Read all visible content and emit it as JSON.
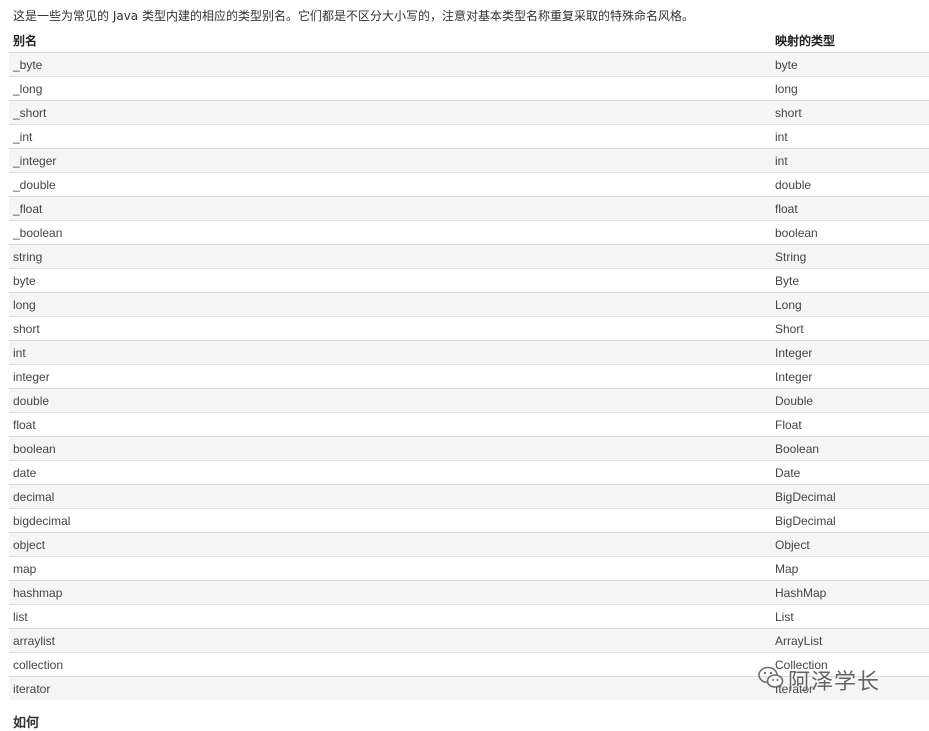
{
  "intro_text": "这是一些为常见的 Java 类型内建的相应的类型别名。它们都是不区分大小写的，注意对基本类型名称重复采取的特殊命名风格。",
  "table": {
    "headers": {
      "alias": "别名",
      "mapped_type": "映射的类型"
    },
    "rows": [
      {
        "alias": "_byte",
        "type": "byte"
      },
      {
        "alias": "_long",
        "type": "long"
      },
      {
        "alias": "_short",
        "type": "short"
      },
      {
        "alias": "_int",
        "type": "int"
      },
      {
        "alias": "_integer",
        "type": "int"
      },
      {
        "alias": "_double",
        "type": "double"
      },
      {
        "alias": "_float",
        "type": "float"
      },
      {
        "alias": "_boolean",
        "type": "boolean"
      },
      {
        "alias": "string",
        "type": "String"
      },
      {
        "alias": "byte",
        "type": "Byte"
      },
      {
        "alias": "long",
        "type": "Long"
      },
      {
        "alias": "short",
        "type": "Short"
      },
      {
        "alias": "int",
        "type": "Integer"
      },
      {
        "alias": "integer",
        "type": "Integer"
      },
      {
        "alias": "double",
        "type": "Double"
      },
      {
        "alias": "float",
        "type": "Float"
      },
      {
        "alias": "boolean",
        "type": "Boolean"
      },
      {
        "alias": "date",
        "type": "Date"
      },
      {
        "alias": "decimal",
        "type": "BigDecimal"
      },
      {
        "alias": "bigdecimal",
        "type": "BigDecimal"
      },
      {
        "alias": "object",
        "type": "Object"
      },
      {
        "alias": "map",
        "type": "Map"
      },
      {
        "alias": "hashmap",
        "type": "HashMap"
      },
      {
        "alias": "list",
        "type": "List"
      },
      {
        "alias": "arraylist",
        "type": "ArrayList"
      },
      {
        "alias": "collection",
        "type": "Collection"
      },
      {
        "alias": "iterator",
        "type": "Iterator"
      }
    ]
  },
  "watermark": {
    "text": "阿泽学长",
    "icon": "wechat-icon"
  },
  "next_heading": "如何"
}
